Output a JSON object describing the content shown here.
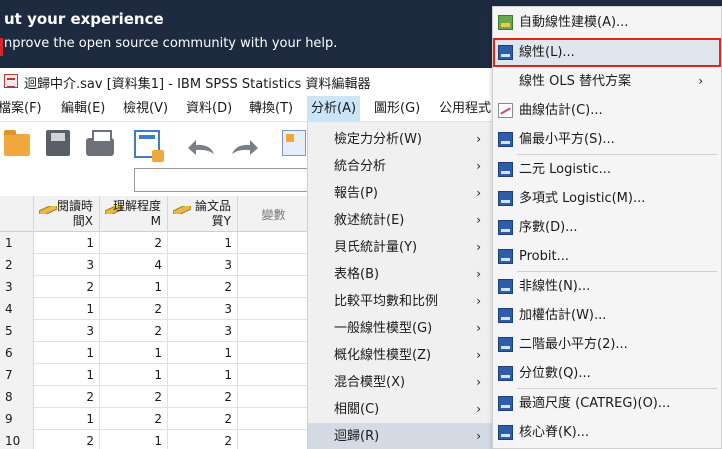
{
  "banner": {
    "title": "ut your experience",
    "subtitle": "nprove the open source community with your help."
  },
  "window": {
    "title": "迴歸中介.sav [資料集1] - IBM SPSS Statistics 資料編輯器"
  },
  "menubar": {
    "items": [
      "檔案(F)",
      "編輯(E)",
      "檢視(V)",
      "資料(D)",
      "轉換(T)",
      "分析(A)",
      "圖形(G)",
      "公用程式"
    ]
  },
  "grid": {
    "columns": [
      {
        "label": "閱讀時\n間X",
        "type": "scale"
      },
      {
        "label": "理解程度\nM",
        "type": "scale"
      },
      {
        "label": "論文品\n質Y",
        "type": "scale"
      },
      {
        "label": "變數",
        "type": "empty"
      }
    ],
    "rows": [
      {
        "n": "1",
        "values": [
          "1",
          "2",
          "1"
        ]
      },
      {
        "n": "2",
        "values": [
          "3",
          "4",
          "3"
        ]
      },
      {
        "n": "3",
        "values": [
          "2",
          "1",
          "2"
        ]
      },
      {
        "n": "4",
        "values": [
          "1",
          "2",
          "3"
        ]
      },
      {
        "n": "5",
        "values": [
          "3",
          "2",
          "3"
        ]
      },
      {
        "n": "6",
        "values": [
          "1",
          "1",
          "1"
        ]
      },
      {
        "n": "7",
        "values": [
          "1",
          "1",
          "1"
        ]
      },
      {
        "n": "8",
        "values": [
          "2",
          "2",
          "2"
        ]
      },
      {
        "n": "9",
        "values": [
          "1",
          "2",
          "2"
        ]
      },
      {
        "n": "10",
        "values": [
          "2",
          "1",
          "2"
        ]
      }
    ]
  },
  "analyze_menu": {
    "items": [
      {
        "label": "檢定力分析(W)",
        "arrow": "›"
      },
      {
        "label": "統合分析",
        "arrow": "›"
      },
      {
        "label": "報告(P)",
        "arrow": "›"
      },
      {
        "label": "敘述統計(E)",
        "arrow": "›"
      },
      {
        "label": "貝氏統計量(Y)",
        "arrow": "›"
      },
      {
        "label": "表格(B)",
        "arrow": "›"
      },
      {
        "label": "比較平均數和比例",
        "arrow": "›"
      },
      {
        "label": "一般線性模型(G)",
        "arrow": "›"
      },
      {
        "label": "概化線性模型(Z)",
        "arrow": "›"
      },
      {
        "label": "混合模型(X)",
        "arrow": "›"
      },
      {
        "label": "相關(C)",
        "arrow": "›"
      },
      {
        "label": "迴歸(R)",
        "arrow": "›"
      }
    ]
  },
  "regression_menu": {
    "items": [
      {
        "label": "自動線性建模(A)...",
        "icon": "auto-linear-icon",
        "arrow": ""
      },
      {
        "label": "線性(L)...",
        "icon": "linear-icon",
        "arrow": ""
      },
      {
        "label": "線性 OLS 替代方案",
        "icon": "",
        "arrow": "›"
      },
      {
        "label": "曲線估計(C)...",
        "icon": "curve-estimation-icon",
        "arrow": ""
      },
      {
        "label": "偏最小平方(S)...",
        "icon": "pls-icon",
        "arrow": ""
      },
      {
        "label": "二元 Logistic...",
        "icon": "binary-logistic-icon",
        "arrow": ""
      },
      {
        "label": "多項式 Logistic(M)...",
        "icon": "multinomial-logistic-icon",
        "arrow": ""
      },
      {
        "label": "序數(D)...",
        "icon": "ordinal-icon",
        "arrow": ""
      },
      {
        "label": "Probit...",
        "icon": "probit-icon",
        "arrow": ""
      },
      {
        "label": "非線性(N)...",
        "icon": "nonlinear-icon",
        "arrow": ""
      },
      {
        "label": "加權估計(W)...",
        "icon": "weight-estimation-icon",
        "arrow": ""
      },
      {
        "label": "二階最小平方(2)...",
        "icon": "two-stage-ls-icon",
        "arrow": ""
      },
      {
        "label": "分位數(Q)...",
        "icon": "quantile-icon",
        "arrow": ""
      },
      {
        "label": "最適尺度 (CATREG)(O)...",
        "icon": "catreg-icon",
        "arrow": ""
      },
      {
        "label": "核心脊(K)...",
        "icon": "kernel-ridge-icon",
        "arrow": ""
      }
    ]
  }
}
